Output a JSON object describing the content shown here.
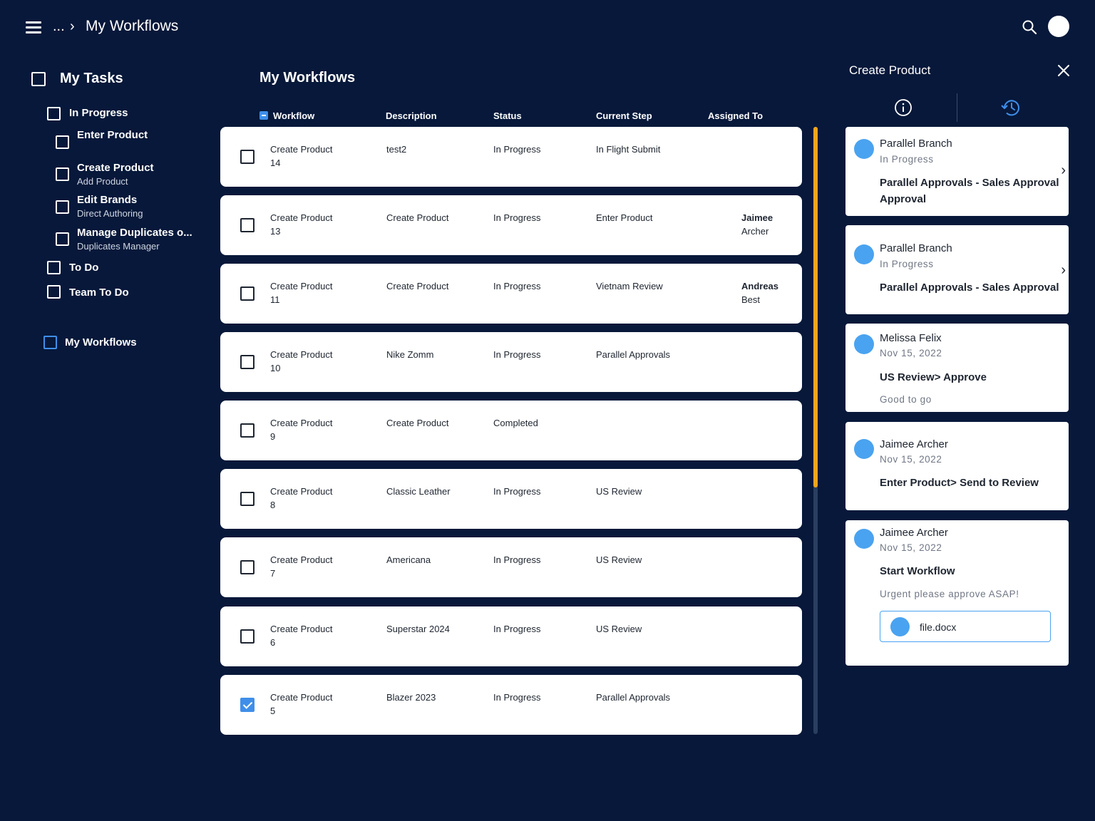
{
  "header": {
    "breadcrumb_ellipsis": "...",
    "breadcrumb_separator": "›",
    "title": "My Workflows"
  },
  "sidebar": {
    "my_tasks": "My Tasks",
    "in_progress": "In Progress",
    "tasks": [
      {
        "label": "Enter Product",
        "sub": ""
      },
      {
        "label": "Create Product",
        "sub": "Add Product"
      },
      {
        "label": "Edit Brands",
        "sub": "Direct Authoring"
      },
      {
        "label": "Manage Duplicates o...",
        "sub": "Duplicates Manager"
      }
    ],
    "to_do": "To Do",
    "team_to_do": "Team To Do",
    "my_workflows": "My Workflows"
  },
  "main": {
    "title": "My Workflows",
    "columns": {
      "workflow": "Workflow",
      "description": "Description",
      "status": "Status",
      "current_step": "Current Step",
      "assigned_to": "Assigned To"
    },
    "rows": [
      {
        "workflow": "Create Product",
        "num": "14",
        "description": "test2",
        "status": "In Progress",
        "step": "In Flight Submit",
        "assignee_first": "",
        "assignee_last": "",
        "checked": false
      },
      {
        "workflow": "Create Product",
        "num": "13",
        "description": "Create Product",
        "status": "In Progress",
        "step": "Enter Product",
        "assignee_first": "Jaimee",
        "assignee_last": "Archer",
        "checked": false
      },
      {
        "workflow": "Create Product",
        "num": "11",
        "description": "Create Product",
        "status": "In Progress",
        "step": "Vietnam Review",
        "assignee_first": "Andreas",
        "assignee_last": "Best",
        "checked": false
      },
      {
        "workflow": "Create Product",
        "num": "10",
        "description": "Nike Zomm",
        "status": "In Progress",
        "step": "Parallel Approvals",
        "assignee_first": "",
        "assignee_last": "",
        "checked": false
      },
      {
        "workflow": "Create Product",
        "num": "9",
        "description": "Create Product",
        "status": "Completed",
        "step": "",
        "assignee_first": "",
        "assignee_last": "",
        "checked": false
      },
      {
        "workflow": "Create Product",
        "num": "8",
        "description": "Classic Leather",
        "status": "In Progress",
        "step": "US Review",
        "assignee_first": "",
        "assignee_last": "",
        "checked": false
      },
      {
        "workflow": "Create Product",
        "num": "7",
        "description": "Americana",
        "status": "In Progress",
        "step": "US Review",
        "assignee_first": "",
        "assignee_last": "",
        "checked": false
      },
      {
        "workflow": "Create Product",
        "num": "6",
        "description": "Superstar 2024",
        "status": "In Progress",
        "step": "US Review",
        "assignee_first": "",
        "assignee_last": "",
        "checked": false
      },
      {
        "workflow": "Create Product",
        "num": "5",
        "description": "Blazer 2023",
        "status": "In Progress",
        "step": "Parallel Approvals",
        "assignee_first": "",
        "assignee_last": "",
        "checked": true
      }
    ]
  },
  "panel": {
    "title": "Create Product",
    "cards": [
      {
        "name": "Parallel Branch",
        "meta": "In Progress",
        "action": "Parallel Approvals - Sales Approval Approval"
      },
      {
        "name": "Parallel Branch",
        "meta": "In Progress",
        "action": "Parallel Approvals - Sales Approval"
      },
      {
        "name": "Melissa Felix",
        "meta": "Nov 15, 2022",
        "action": "US Review> Approve",
        "note": "Good to go"
      },
      {
        "name": "Jaimee Archer",
        "meta": "Nov 15, 2022",
        "action": "Enter Product> Send to Review"
      },
      {
        "name": "Jaimee Archer",
        "meta": "Nov 15, 2022",
        "action": "Start Workflow",
        "note": "Urgent please approve ASAP!",
        "attachment": "file.docx"
      }
    ]
  },
  "colors": {
    "background": "#07183a",
    "accent_blue": "#3f8fea",
    "scroll_thumb": "#f3a51c",
    "avatar_dot": "#4aa3f0"
  }
}
